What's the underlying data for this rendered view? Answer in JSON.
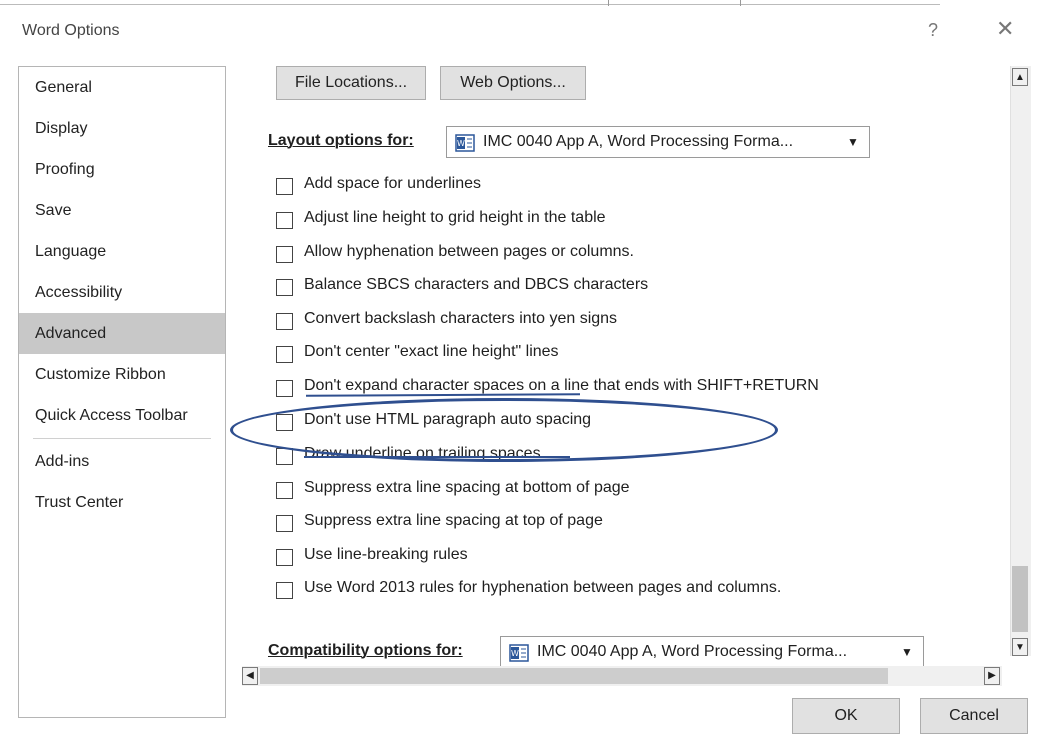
{
  "window": {
    "title": "Word Options",
    "help": "?",
    "close": "✕"
  },
  "sidebar": {
    "items": [
      {
        "label": "General"
      },
      {
        "label": "Display"
      },
      {
        "label": "Proofing"
      },
      {
        "label": "Save"
      },
      {
        "label": "Language"
      },
      {
        "label": "Accessibility"
      },
      {
        "label": "Advanced",
        "active": true
      },
      {
        "label": "Customize Ribbon"
      },
      {
        "label": "Quick Access Toolbar"
      },
      {
        "label": "Add-ins"
      },
      {
        "label": "Trust Center"
      }
    ]
  },
  "buttons": {
    "file_locations": "File Locations...",
    "web_options": "Web Options..."
  },
  "layout": {
    "label": "Layout options for:",
    "document": "IMC 0040 App A, Word Processing Forma..."
  },
  "options": [
    {
      "label": "Add space for underlines",
      "checked": false
    },
    {
      "label": "Adjust line height to grid height in the table",
      "checked": false
    },
    {
      "label": "Allow hyphenation between pages or columns.",
      "checked": false
    },
    {
      "label": "Balance SBCS characters and DBCS characters",
      "checked": false
    },
    {
      "label": "Convert backslash characters into yen signs",
      "checked": false
    },
    {
      "label": "Don't center \"exact line height\" lines",
      "checked": false
    },
    {
      "label": "Don't expand character spaces on a line that ends with SHIFT+RETURN",
      "checked": false
    },
    {
      "label": "Don't use HTML paragraph auto spacing",
      "checked": false
    },
    {
      "label": "Draw underline on trailing spaces",
      "checked": false
    },
    {
      "label": "Suppress extra line spacing at bottom of page",
      "checked": false
    },
    {
      "label": "Suppress extra line spacing at top of page",
      "checked": false
    },
    {
      "label": "Use line-breaking rules",
      "checked": false
    },
    {
      "label": "Use Word 2013 rules for hyphenation between pages and columns.",
      "checked": false
    }
  ],
  "compatibility": {
    "label": "Compatibility options for:",
    "document": "IMC 0040 App A, Word Processing Forma..."
  },
  "footer": {
    "ok": "OK",
    "cancel": "Cancel"
  },
  "colors": {
    "annotation": "#2f4f8f",
    "active_item": "#c8c8c8"
  }
}
